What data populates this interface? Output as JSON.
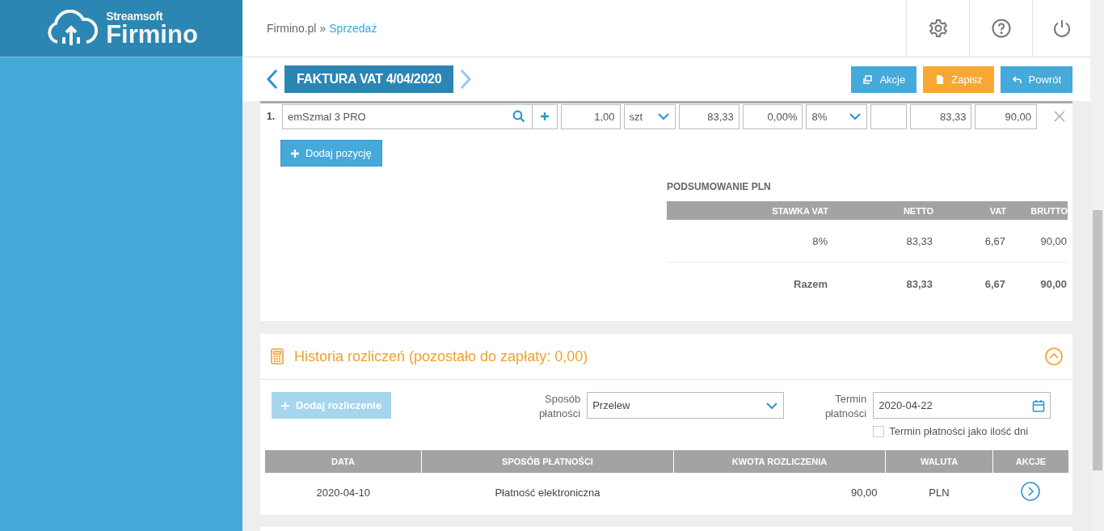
{
  "brand": {
    "small": "Streamsoft",
    "large": "Firmino"
  },
  "breadcrumb": {
    "home": "Firmino.pl",
    "separator": "»",
    "current": "Sprzedaż"
  },
  "document": {
    "title": "FAKTURA VAT 4/04/2020"
  },
  "actions": [
    {
      "label": "Akcje",
      "kind": "actions"
    },
    {
      "label": "Zapisz",
      "kind": "save"
    },
    {
      "label": "Powrót",
      "kind": "back"
    }
  ],
  "item": {
    "number": "1.",
    "name": "emSzmal 3 PRO",
    "quantity": "1,00",
    "unit": "szt",
    "net_price": "83,33",
    "discount": "0,00%",
    "vat_rate": "8%",
    "net_value": "83,33",
    "gross_value": "90,00"
  },
  "add_item_button": "Dodaj pozycję",
  "summary": {
    "title": "PODSUMOWANIE PLN",
    "columns": [
      "STAWKA VAT",
      "NETTO",
      "VAT",
      "BRUTTO"
    ],
    "rows": [
      [
        "8%",
        "83,33",
        "6,67",
        "90,00"
      ]
    ],
    "total": [
      "Razem",
      "83,33",
      "6,67",
      "90,00"
    ]
  },
  "history": {
    "title": "Historia rozliczeń (pozostało do zapłaty: 0,00)",
    "expanded": true,
    "add_button": {
      "label": "Dodaj rozliczenie",
      "disabled": true
    },
    "payment_method": {
      "label": "Sposób płatności",
      "value": "Przelew"
    },
    "due_date": {
      "label": "Termin płatności",
      "value": "2020-04-22"
    },
    "days_checkbox": {
      "label": "Termin płatności jako ilość dni",
      "checked": false
    },
    "columns": [
      "DATA",
      "SPOSÓB PŁATNOŚCI",
      "KWOTA ROZLICZENIA",
      "WALUTA",
      "AKCJE"
    ],
    "rows": [
      {
        "date": "2020-04-10",
        "method": "Płatność elektroniczna",
        "amount": "90,00",
        "currency": "PLN"
      }
    ]
  }
}
